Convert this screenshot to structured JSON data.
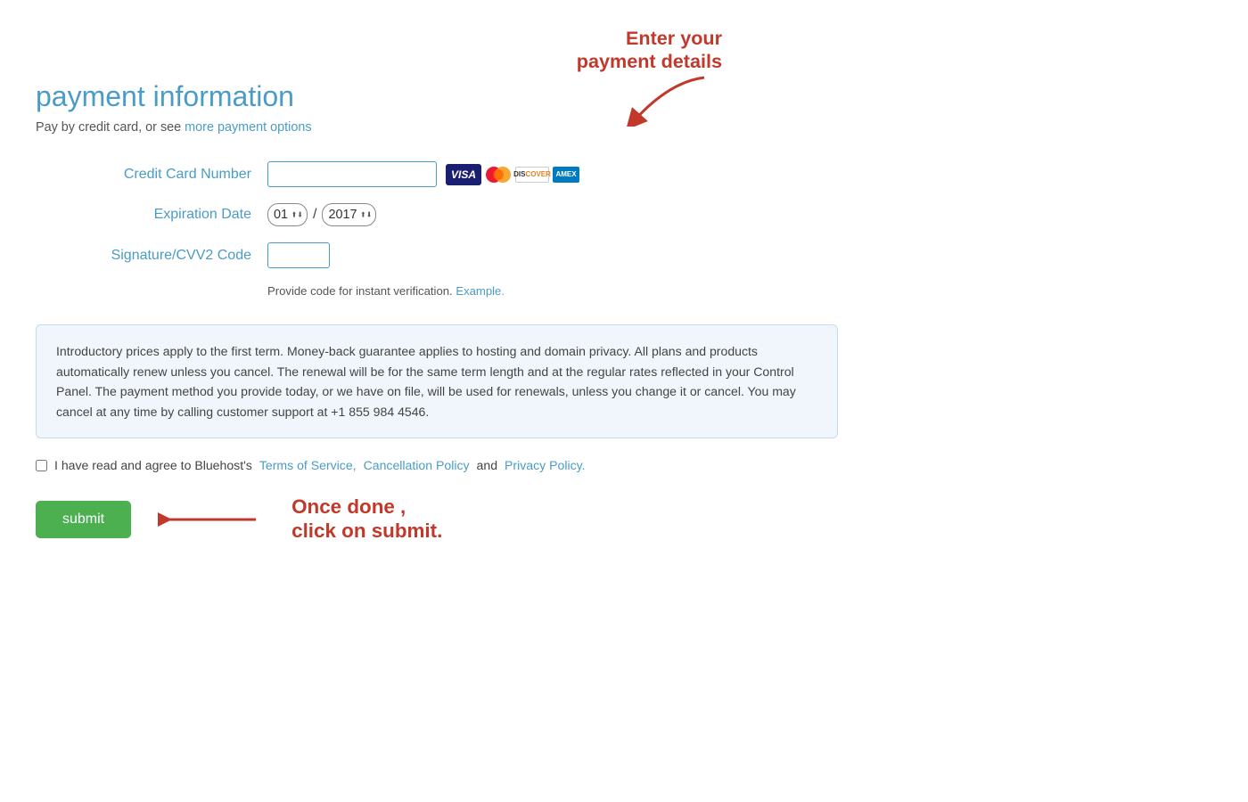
{
  "page": {
    "title": "payment information",
    "subtitle": "Pay by credit card, or see",
    "more_options_link": "more payment options",
    "annotation_callout": "Enter your\npayment details",
    "form": {
      "credit_card_label": "Credit Card Number",
      "credit_card_placeholder": "",
      "expiration_label": "Expiration Date",
      "expiry_month_value": "01",
      "expiry_year_value": "2017",
      "expiry_separator": "/",
      "cvv_label": "Signature/CVV2 Code",
      "cvv_hint_text": "Provide code for instant verification.",
      "cvv_example_link": "Example.",
      "card_icons": [
        "VISA",
        "MC",
        "DISCOVER",
        "AMEX"
      ]
    },
    "info_box": "Introductory prices apply to the first term. Money-back guarantee applies to hosting and domain privacy. All plans and products automatically renew unless you cancel. The renewal will be for the same term length and at the regular rates reflected in your Control Panel. The payment method you provide today, or we have on file, will be used for renewals, unless you change it or cancel. You may cancel at any time by calling customer support at +1 855 984 4546.",
    "agree": {
      "prefix": "I have read and agree to Bluehost's",
      "terms_link": "Terms of Service,",
      "cancellation_link": "Cancellation Policy",
      "and_text": "and",
      "privacy_link": "Privacy Policy."
    },
    "submit_label": "submit",
    "submit_annotation": "Once done ,\nclick on submit."
  }
}
